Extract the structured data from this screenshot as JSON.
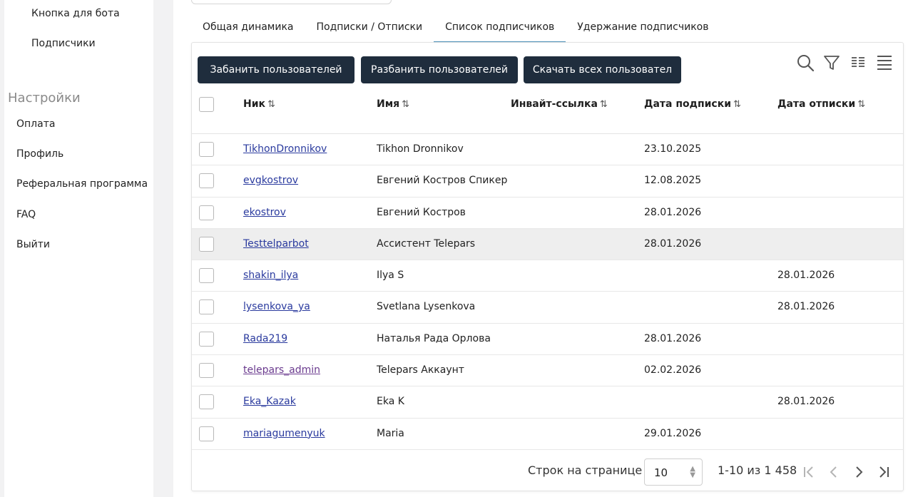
{
  "sidebar": {
    "bot_button": "Кнопка для бота",
    "subscribers": "Подписчики",
    "settings_title": "Настройки",
    "payment": "Оплата",
    "profile": "Профиль",
    "referral": "Реферальная программа",
    "faq": "FAQ",
    "logout": "Выйти"
  },
  "tabs": [
    "Общая динамика",
    "Подписки / Отписки",
    "Список подписчиков",
    "Удержание подписчиков"
  ],
  "active_tab": "Список подписчиков",
  "actions": {
    "ban": "Забанить пользователей",
    "unban": "Разбанить пользователей",
    "download": "Скачать всех пользовател"
  },
  "toolbar_icons": [
    "search-icon",
    "filter-icon",
    "columns-icon",
    "density-icon"
  ],
  "columns": {
    "nick": "Ник",
    "name": "Имя",
    "invite": "Инвайт-ссылка",
    "sub_date": "Дата подписки",
    "unsub_date": "Дата отписки",
    "sort_glyph": "⇅"
  },
  "rows": [
    {
      "nick": "TikhonDronnikov",
      "name": "Tikhon Dronnikov",
      "invite": "",
      "sub_date": "23.10.2025",
      "unsub_date": ""
    },
    {
      "nick": "evgkostrov",
      "name": "Евгений Костров Спикер",
      "invite": "",
      "sub_date": "12.08.2025",
      "unsub_date": ""
    },
    {
      "nick": "ekostrov",
      "name": "Евгений Костров",
      "invite": "",
      "sub_date": "28.01.2026",
      "unsub_date": ""
    },
    {
      "nick": "Testtelparbot",
      "name": "Ассистент Telepars",
      "invite": "",
      "sub_date": "28.01.2026",
      "unsub_date": ""
    },
    {
      "nick": "shakin_ilya",
      "name": "Ilya S",
      "invite": "",
      "sub_date": "",
      "unsub_date": "28.01.2026"
    },
    {
      "nick": "lysenkova_ya",
      "name": "Svetlana Lysenkova",
      "invite": "",
      "sub_date": "",
      "unsub_date": "28.01.2026"
    },
    {
      "nick": "Rada219",
      "name": "Наталья Рада Орлова",
      "invite": "",
      "sub_date": "28.01.2026",
      "unsub_date": ""
    },
    {
      "nick": "telepars_admin",
      "name": "Telepars Аккаунт",
      "invite": "",
      "sub_date": "02.02.2026",
      "unsub_date": ""
    },
    {
      "nick": "Eka_Kazak",
      "name": "Eka K",
      "invite": "",
      "sub_date": "",
      "unsub_date": "28.01.2026"
    },
    {
      "nick": "mariagumenyuk",
      "name": "Maria",
      "invite": "",
      "sub_date": "29.01.2026",
      "unsub_date": ""
    }
  ],
  "pagination": {
    "rows_label": "Строк на странице",
    "rows_per_page": "10",
    "range": "1-10 из 1 458"
  },
  "colors": {
    "button_bg": "#1f2d3d",
    "active_tab_underline": "#4a90b8",
    "link": "#2a3a9e",
    "link_visited": "#6a3a8e",
    "row_highlight": "#eeeeee"
  }
}
